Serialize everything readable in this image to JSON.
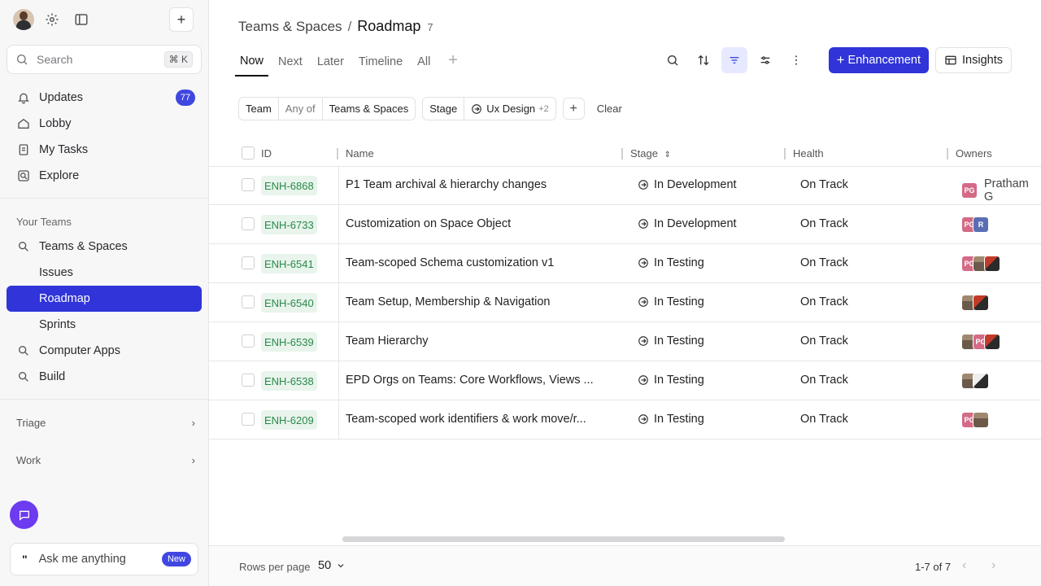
{
  "sidebar": {
    "search": {
      "placeholder": "Search",
      "shortcut": "⌘ K"
    },
    "top_items": [
      {
        "label": "Updates",
        "icon": "bell-icon",
        "badge": "77"
      },
      {
        "label": "Lobby",
        "icon": "home-icon"
      },
      {
        "label": "My Tasks",
        "icon": "tasks-icon"
      },
      {
        "label": "Explore",
        "icon": "explore-icon"
      }
    ],
    "your_teams_label": "Your Teams",
    "teams": [
      {
        "label": "Teams & Spaces",
        "icon": "team-icon"
      },
      {
        "label": "Issues",
        "sub": true
      },
      {
        "label": "Roadmap",
        "sub": true,
        "active": true
      },
      {
        "label": "Sprints",
        "sub": true
      },
      {
        "label": "Computer Apps",
        "icon": "team-icon"
      },
      {
        "label": "Build",
        "icon": "team-icon"
      }
    ],
    "triage_label": "Triage",
    "work_label": "Work",
    "ask": {
      "label": "Ask me anything",
      "badge": "New"
    }
  },
  "header": {
    "breadcrumb_parent": "Teams & Spaces",
    "breadcrumb_sep": "/",
    "title": "Roadmap",
    "count": "7"
  },
  "tabs": [
    "Now",
    "Next",
    "Later",
    "Timeline",
    "All"
  ],
  "toolbar": {
    "primary": "Enhancement",
    "secondary": "Insights"
  },
  "filters": {
    "team": {
      "field": "Team",
      "op": "Any of",
      "value": "Teams & Spaces"
    },
    "stage": {
      "field": "Stage",
      "value": "Ux Design",
      "more": "+2"
    },
    "clear": "Clear"
  },
  "columns": {
    "id": "ID",
    "name": "Name",
    "stage": "Stage",
    "health": "Health",
    "owners": "Owners"
  },
  "rows": [
    {
      "id": "ENH-6868",
      "name": "P1 Team archival & hierarchy changes",
      "stage": "In Development",
      "health": "On Track",
      "owner_name": "Pratham G"
    },
    {
      "id": "ENH-6733",
      "name": "Customization on Space Object",
      "stage": "In Development",
      "health": "On Track"
    },
    {
      "id": "ENH-6541",
      "name": "Team-scoped Schema customization v1",
      "stage": "In Testing",
      "health": "On Track"
    },
    {
      "id": "ENH-6540",
      "name": "Team Setup, Membership & Navigation",
      "stage": "In Testing",
      "health": "On Track"
    },
    {
      "id": "ENH-6539",
      "name": "Team Hierarchy",
      "stage": "In Testing",
      "health": "On Track"
    },
    {
      "id": "ENH-6538",
      "name": "EPD Orgs on Teams: Core Workflows, Views ...",
      "stage": "In Testing",
      "health": "On Track"
    },
    {
      "id": "ENH-6209",
      "name": "Team-scoped work identifiers & work move/r...",
      "stage": "In Testing",
      "health": "On Track"
    }
  ],
  "avatars": {
    "pg": "PG",
    "r": "R"
  },
  "footer": {
    "rows_per_page_label": "Rows per page",
    "rows_per_page": "50",
    "range": "1-7 of 7"
  },
  "colors": {
    "accent": "#3034d9",
    "id_tag_bg": "#e8f4ec",
    "id_tag_text": "#2a8a4a",
    "chat_button": "#6d3bf0"
  }
}
